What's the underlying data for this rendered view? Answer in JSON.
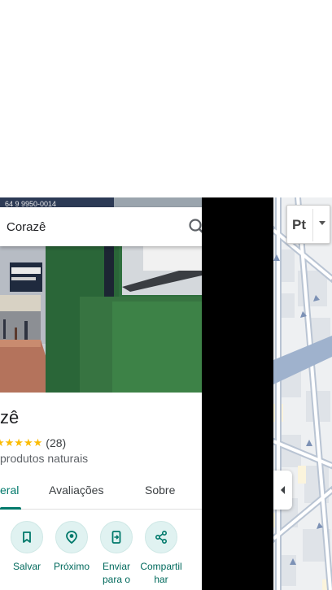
{
  "search": {
    "value": "Corazê"
  },
  "photo": {
    "phone_text": "64 9 9950-0014"
  },
  "place": {
    "name": "zê",
    "stars": "★★★★★",
    "review_count": "(28)",
    "category": "produtos naturais"
  },
  "tabs": [
    {
      "label": "eral",
      "active": true
    },
    {
      "label": "Avaliações",
      "active": false
    },
    {
      "label": "Sobre",
      "active": false
    }
  ],
  "actions": [
    {
      "label": "Salvar",
      "icon": "bookmark-icon"
    },
    {
      "label": "Próximo",
      "icon": "nearby-icon"
    },
    {
      "label": "Enviar\npara o",
      "icon": "send-to-phone-icon"
    },
    {
      "label": "Compartilhar",
      "icon": "share-icon"
    }
  ],
  "map": {
    "layer_label": "Pt"
  },
  "colors": {
    "accent": "#00796b",
    "accent_bg": "#e0f2f1",
    "star": "#fbbc04",
    "road": "#aab9cd",
    "arrow": "#7c91b5"
  }
}
